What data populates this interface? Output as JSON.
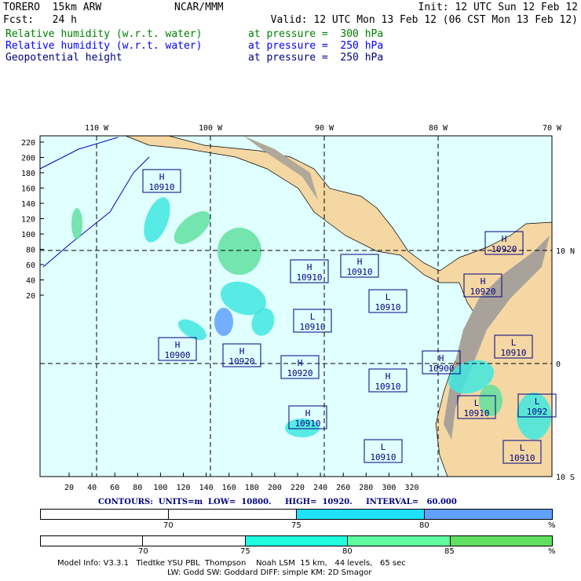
{
  "header": {
    "model": "TORERO  15km ARW",
    "org": "NCAR/MMM",
    "init": "Init: 12 UTC Sun 12 Feb 12",
    "fcst": "Fcst:   24 h",
    "valid": "Valid: 12 UTC Mon 13 Feb 12 (06 CST Mon 13 Feb 12)"
  },
  "fields": [
    {
      "name": "Relative humidity (w.r.t. water)",
      "level": "at pressure =  300 hPa",
      "color": "#008000"
    },
    {
      "name": "Relative humidity (w.r.t. water)",
      "level": "at pressure =  250 hPa",
      "color": "#0000ff"
    },
    {
      "name": "Geopotential height",
      "level": "at pressure =  250 hPa",
      "color": "#000080"
    }
  ],
  "axes": {
    "top": [
      "110 W",
      "100 W",
      "90 W",
      "80 W",
      "70 W"
    ],
    "right": [
      "10 N",
      "0",
      "10 S"
    ],
    "left": [
      "220",
      "200",
      "180",
      "160",
      "140",
      "120",
      "100",
      "80",
      "60",
      "40",
      "20"
    ],
    "bottom": [
      "20",
      "40",
      "60",
      "80",
      "100",
      "120",
      "140",
      "160",
      "180",
      "200",
      "220",
      "240",
      "260",
      "280",
      "300",
      "320"
    ]
  },
  "centers": [
    {
      "t": "H",
      "v": "10910"
    },
    {
      "t": "H",
      "v": "10910"
    },
    {
      "t": "H",
      "v": "10910"
    },
    {
      "t": "L",
      "v": "10910"
    },
    {
      "t": "L",
      "v": "10910"
    },
    {
      "t": "H",
      "v": "10900"
    },
    {
      "t": "H",
      "v": "10920"
    },
    {
      "t": "H",
      "v": "10920"
    },
    {
      "t": "H",
      "v": "10910"
    },
    {
      "t": "H",
      "v": "10910"
    },
    {
      "t": "L",
      "v": "10910"
    },
    {
      "t": "H",
      "v": "10920"
    },
    {
      "t": "H",
      "v": "10920"
    },
    {
      "t": "L",
      "v": "10910"
    },
    {
      "t": "H",
      "v": "10900"
    },
    {
      "t": "L",
      "v": "10910"
    },
    {
      "t": "L",
      "v": "1092"
    },
    {
      "t": "L",
      "v": "10910"
    }
  ],
  "contours": "CONTOURS:  UNITS=m  LOW=  10800.     HIGH=  10920.     INTERVAL=   60.000",
  "legend1": {
    "labels": [
      "70",
      "75",
      "80",
      "%"
    ],
    "colors": [
      "#ffffff",
      "#ffffff",
      "#20e0ff",
      "#60a0ff"
    ]
  },
  "legend2": {
    "labels": [
      "70",
      "75",
      "80",
      "85",
      "%"
    ],
    "colors": [
      "#ffffff",
      "#ffffff",
      "#20ffe0",
      "#60ffa0",
      "#60e060"
    ]
  },
  "footer": [
    "Model Info: V3.3.1   Tiedtke YSU PBL  Thompson    Noah LSM  15 km,   44 levels,   65 sec",
    "LW: Godd SW: Goddard DIFF: simple KM: 2D Smagor"
  ]
}
